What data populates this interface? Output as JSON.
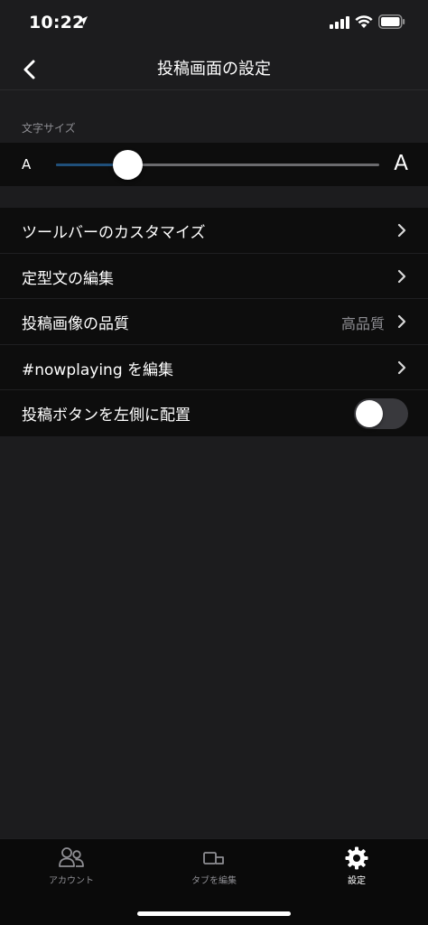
{
  "status_bar": {
    "time": "10:22"
  },
  "nav": {
    "title": "投稿画面の設定"
  },
  "font_size": {
    "section_header": "文字サイズ",
    "small_label": "A",
    "large_label": "A",
    "slider_value_fraction": 0.22
  },
  "settings": [
    {
      "label": "ツールバーのカスタマイズ",
      "value": "",
      "type": "disclosure"
    },
    {
      "label": "定型文の編集",
      "value": "",
      "type": "disclosure"
    },
    {
      "label": "投稿画像の品質",
      "value": "高品質",
      "type": "disclosure"
    },
    {
      "label": "#nowplaying を編集",
      "value": "",
      "type": "disclosure"
    },
    {
      "label": "投稿ボタンを左側に配置",
      "value": "",
      "type": "toggle",
      "on": false
    }
  ],
  "tabs": [
    {
      "label": "アカウント",
      "icon": "accounts-icon",
      "active": false
    },
    {
      "label": "タブを編集",
      "icon": "tabs-edit-icon",
      "active": false
    },
    {
      "label": "設定",
      "icon": "gear-icon",
      "active": true
    }
  ],
  "colors": {
    "background": "#1c1c1e",
    "row_background": "#0d0d0d",
    "slider_fill": "#1f4f7a",
    "secondary_text": "#8e8e93"
  }
}
